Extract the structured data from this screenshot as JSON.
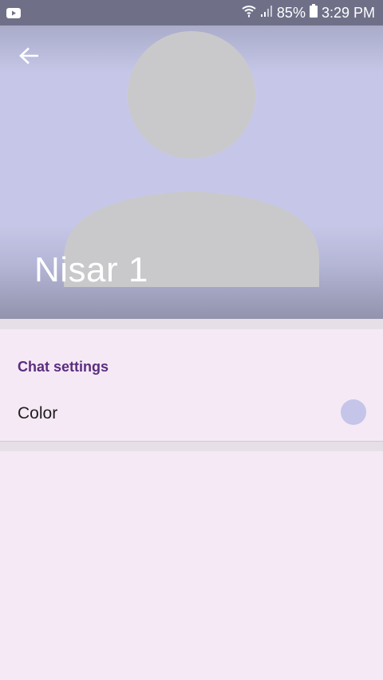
{
  "status_bar": {
    "battery": "85%",
    "time": "3:29 PM",
    "icons": [
      "youtube-icon",
      "wifi-icon",
      "signal-icon",
      "battery-icon"
    ]
  },
  "header": {
    "contact_name": "Nisar 1",
    "back_icon": "arrow-back-icon"
  },
  "settings": {
    "section_title": "Chat settings",
    "color_label": "Color",
    "color_value": "#c4c5e8"
  },
  "colors": {
    "status_bar": "#6f7088",
    "header": "#c6c7e8",
    "section_title": "#5b2d7e",
    "background": "#f5e9f6"
  }
}
